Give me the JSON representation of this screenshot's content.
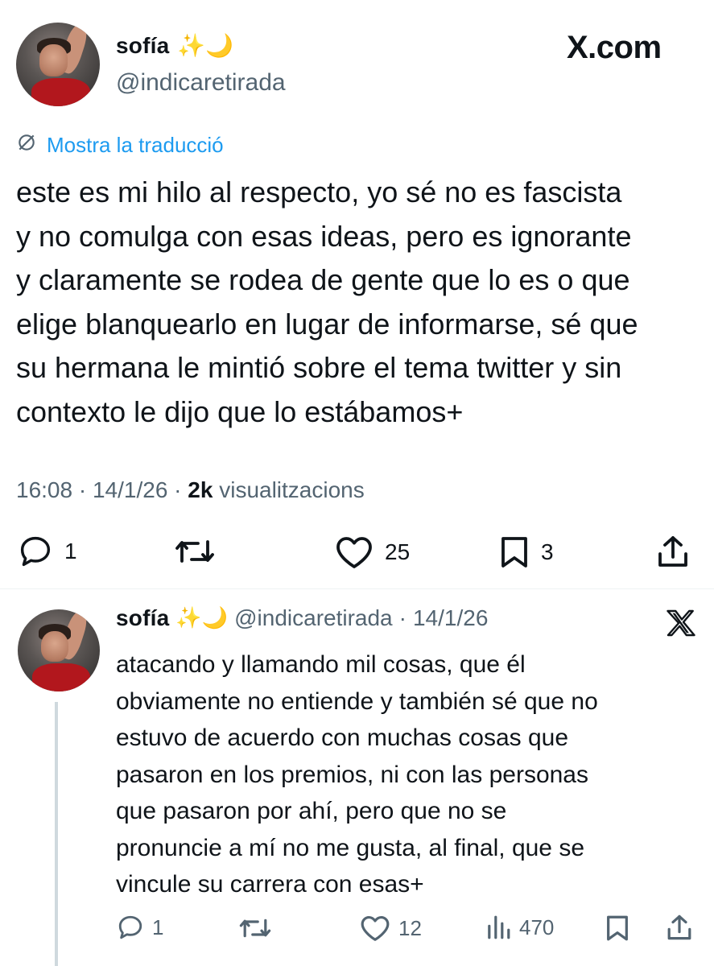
{
  "main_tweet": {
    "display_name": "sofía",
    "emoji": "✨🌙",
    "handle": "@indicaretirada",
    "brand": "X.com",
    "translate_label": "Mostra la traducció",
    "text_lines": [
      "este es mi hilo al respecto, yo sé no es fascista",
      "y no comulga con esas ideas, pero es ignorante",
      "y claramente se rodea de gente que lo es o que",
      "elige blanquearlo en lugar de informarse, sé que",
      "su hermana le mintió sobre el tema twitter y sin",
      "contexto le dijo que lo estábamos+"
    ],
    "time": "16:08",
    "date": "14/1/26",
    "views_count": "2k",
    "views_label": "visualitzacions",
    "separator": "·",
    "actions": {
      "reply_count": "1",
      "retweet_count": "",
      "like_count": "25",
      "bookmark_count": "3"
    }
  },
  "reply_tweet": {
    "display_name": "sofía",
    "emoji": "✨🌙",
    "handle": "@indicaretirada",
    "separator": "·",
    "date": "14/1/26",
    "text_lines": [
      "atacando y llamando mil cosas, que él",
      "obviamente no entiende y también sé que no",
      "estuvo de acuerdo con muchas cosas que",
      "pasaron en los premios, ni con las personas",
      "que pasaron por ahí, pero que no se",
      "pronuncie a mí no me gusta, al final, que se",
      "vincule su carrera con esas+"
    ],
    "actions": {
      "reply_count": "1",
      "like_count": "12",
      "views_count": "470"
    }
  },
  "icons": {
    "translate": "translate-globe-icon",
    "x_logo": "x-logo-icon",
    "reply": "reply-bubble-icon",
    "retweet": "retweet-icon",
    "like": "heart-icon",
    "bookmark": "bookmark-icon",
    "share": "share-icon",
    "views": "views-bars-icon"
  },
  "colors": {
    "text": "#0f1419",
    "secondary": "#536471",
    "link": "#1d9bf0",
    "divider": "#eff3f4"
  }
}
